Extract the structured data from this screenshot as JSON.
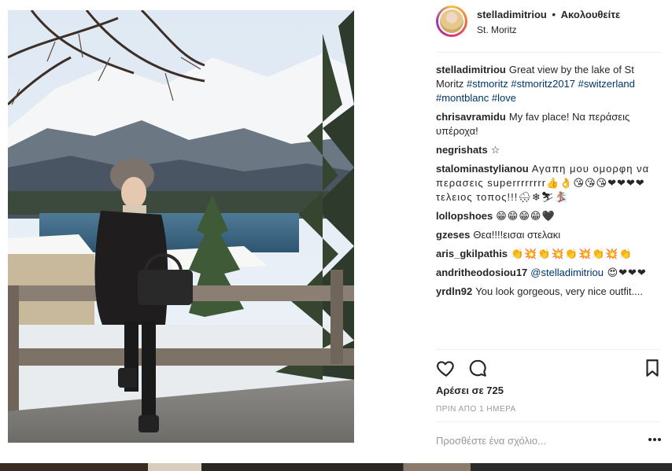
{
  "post": {
    "username": "stelladimitriou",
    "separator": "•",
    "follow_label": "Ακολουθείτε",
    "location": "St. Moritz",
    "caption": {
      "user": "stelladimitriou",
      "text": "Great view by the lake of St Moritz ",
      "hashtags": [
        "#stmoritz",
        "#stmoritz2017",
        "#switzerland",
        "#montblanc",
        "#love"
      ]
    },
    "comments": [
      {
        "user": "chrisavramidu",
        "text": "My fav place! Να περάσεις υπέροχα!"
      },
      {
        "user": "negrishats",
        "text": "☆"
      },
      {
        "user": "stalominastylianou",
        "text": "Αγαπη μου ομορφη να περασεις superrrrrrrr👍👌😘😘😘❤❤❤❤τελειος τοπος!!!🌨❄⛷🏂"
      },
      {
        "user": "lollopshoes",
        "text": "😁😁😁😁🖤"
      },
      {
        "user": "gzeses",
        "text": "Θεα!!!!εισαι στελακι"
      },
      {
        "user": "aris_gkilpathis",
        "text": "👏💥👏💥👏💥👏💥👏"
      },
      {
        "user": "andritheodosiou17",
        "mention": "@stelladimitriou",
        "text": " 😍❤❤❤"
      },
      {
        "user": "yrdln92",
        "text": "You look gorgeous, very nice outfit...."
      }
    ],
    "likes_label": "Αρέσει σε 725",
    "time_label": "ΠΡΙΝ ΑΠΟ 1 ΗΜΕΡΑ",
    "add_comment_placeholder": "Προσθέστε ένα σχόλιο..."
  },
  "icons": {
    "like": "heart-icon",
    "comment": "comment-bubble-icon",
    "save": "bookmark-icon",
    "more": "more-options-icon"
  },
  "colors": {
    "text": "#262626",
    "hashtag": "#003569",
    "muted": "#999999",
    "divider": "#efefef"
  }
}
